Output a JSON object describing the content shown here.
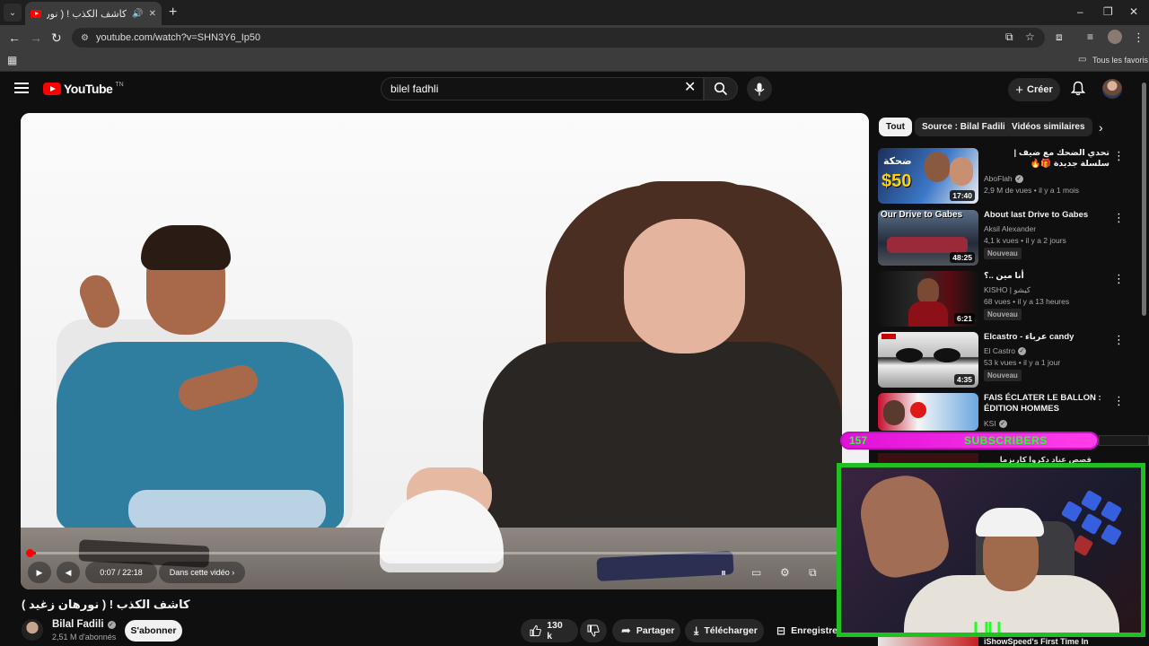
{
  "browser": {
    "tab_title": "كاشف الكذب ! ( نورهان زغيد )",
    "new_tab": "+",
    "url": "youtube.com/watch?v=SHN3Y6_Ip50",
    "bookmarks_folder": "Tous les favoris",
    "window_controls": {
      "minimize": "–",
      "restore": "❐",
      "close": "✕"
    }
  },
  "yt_header": {
    "logo_text": "YouTube",
    "country_code": "TN",
    "search_value": "bilel fadhli",
    "create_label": "Créer"
  },
  "player": {
    "current_time": "0:07 / 22:18",
    "chapter_hint": "Dans cette vidéo ›",
    "progress_fraction": 0.005
  },
  "video": {
    "title": "كاشف الكذب ! ( نورهان زغيد )",
    "channel": "Bilal Fadili",
    "subscribers": "2,51 M d'abonnés",
    "subscribe_label": "S'abonner",
    "likes": "130 k",
    "share_label": "Partager",
    "download_label": "Télécharger",
    "save_label": "Enregistrer"
  },
  "chips": [
    "Tout",
    "Source : Bilal Fadili",
    "Vidéos similaires"
  ],
  "recommendations": [
    {
      "title": "تحدي الضحك مع ضيف | سلسلة جديدة 🎁🔥",
      "channel": "AboFlah",
      "verified": true,
      "meta": "2,9 M de vues • il y a 1 mois",
      "duration": "17:40",
      "new": false,
      "thumb_text": "$50",
      "thumb_sub": "ضحكة"
    },
    {
      "title": "About last Drive to Gabes",
      "channel": "Aksil Alexander",
      "verified": false,
      "meta": "4,1 k vues • il y a 2 jours",
      "duration": "48:25",
      "new": true,
      "new_label": "Nouveau",
      "thumb_text": "Our Drive to Gabes"
    },
    {
      "title": "أنا مين ..؟",
      "channel": "KISHO | كيشو",
      "verified": false,
      "meta": "68 vues • il y a 13 heures",
      "duration": "6:21",
      "new": true,
      "new_label": "Nouveau"
    },
    {
      "title": "Elcastro - عرباء candy",
      "channel": "El Castro",
      "verified": true,
      "meta": "53 k vues • il y a 1 jour",
      "duration": "4:35",
      "new": true,
      "new_label": "Nouveau"
    },
    {
      "title": "FAIS ÉCLATER LE BALLON : ÉDITION HOMMES",
      "channel": "KSI",
      "verified": true,
      "meta": "",
      "duration": "",
      "new": false
    }
  ],
  "overlay": {
    "sub_count": "157",
    "sub_label": "SUBSCRIBERS",
    "partial_rec_title": "قصص عناد دكروا كاريزما",
    "bottom_rec_title": "iShowSpeed's First Time In"
  },
  "colors": {
    "yt_red": "#ff0000",
    "overlay_green": "#20c020",
    "overlay_magenta": "#e011d9"
  }
}
